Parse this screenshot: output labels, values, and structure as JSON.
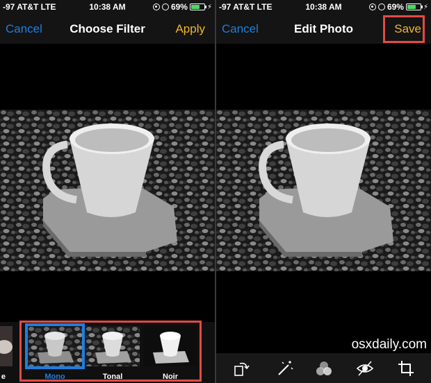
{
  "left_screen": {
    "status": {
      "carrier": "-97 AT&T  LTE",
      "time": "10:38 AM",
      "battery": "69%",
      "battery_level": 0.69
    },
    "nav": {
      "cancel_label": "Cancel",
      "title": "Choose Filter",
      "apply_label": "Apply"
    },
    "filters": [
      {
        "label": "e",
        "selected": false
      },
      {
        "label": "Mono",
        "selected": true
      },
      {
        "label": "Tonal",
        "selected": false
      },
      {
        "label": "Noir",
        "selected": false
      }
    ]
  },
  "right_screen": {
    "status": {
      "carrier": "-97 AT&T  LTE",
      "time": "10:38 AM",
      "battery": "69%",
      "battery_level": 0.69
    },
    "nav": {
      "cancel_label": "Cancel",
      "title": "Edit Photo",
      "save_label": "Save"
    },
    "tools": [
      "rotate-icon",
      "magic-wand-icon",
      "filters-icon",
      "red-eye-icon",
      "crop-icon"
    ]
  },
  "watermark": "osxdaily.com",
  "colors": {
    "accent_blue": "#1e7fe0",
    "accent_yellow": "#f1b52d",
    "highlight_red": "#e24b45",
    "battery_green": "#4cd964"
  }
}
